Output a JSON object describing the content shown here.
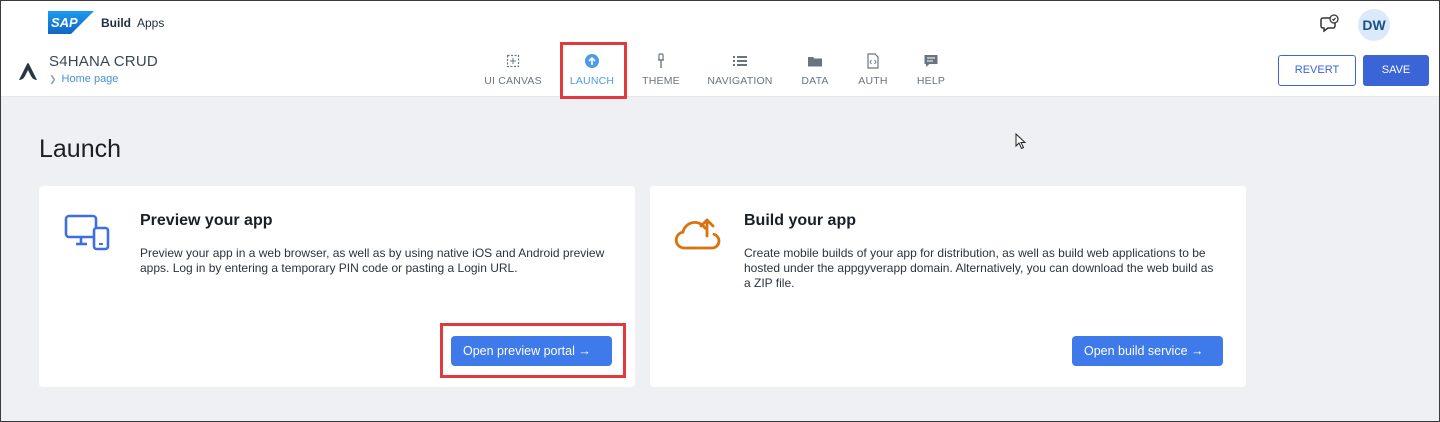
{
  "shell": {
    "logo_text": "SAP",
    "product": "Build",
    "section": "Apps",
    "avatar_initials": "DW",
    "brand_color": "#1a73e8"
  },
  "app": {
    "title": "S4HANA CRUD",
    "breadcrumb": "Home page"
  },
  "nav": {
    "active": "LAUNCH",
    "items": [
      {
        "label": "UI CANVAS",
        "icon": "canvas-icon"
      },
      {
        "label": "LAUNCH",
        "icon": "upload-circle-icon"
      },
      {
        "label": "THEME",
        "icon": "brush-icon"
      },
      {
        "label": "NAVIGATION",
        "icon": "list-icon"
      },
      {
        "label": "DATA",
        "icon": "folder-icon"
      },
      {
        "label": "AUTH",
        "icon": "code-file-icon"
      },
      {
        "label": "HELP",
        "icon": "chat-icon"
      }
    ]
  },
  "actions": {
    "revert": "REVERT",
    "save": "SAVE"
  },
  "page": {
    "title": "Launch"
  },
  "cards": [
    {
      "title": "Preview your app",
      "description": "Preview your app in a web browser, as well as by using native iOS and Android preview apps. Log in by entering a temporary PIN code or pasting a Login URL.",
      "button": "Open preview portal →",
      "icon": "devices-icon"
    },
    {
      "title": "Build your app",
      "description": "Create mobile builds of your app for distribution, as well as build web applications to be hosted under the appgyverapp domain. Alternatively, you can download the web build as a ZIP file.",
      "button": "Open build service →",
      "icon": "cloud-upload-icon"
    }
  ],
  "colors": {
    "accent": "#3e7aea",
    "highlight": "#e0393e",
    "build_icon": "#d9730d",
    "preview_icon": "#3e6fe0"
  }
}
